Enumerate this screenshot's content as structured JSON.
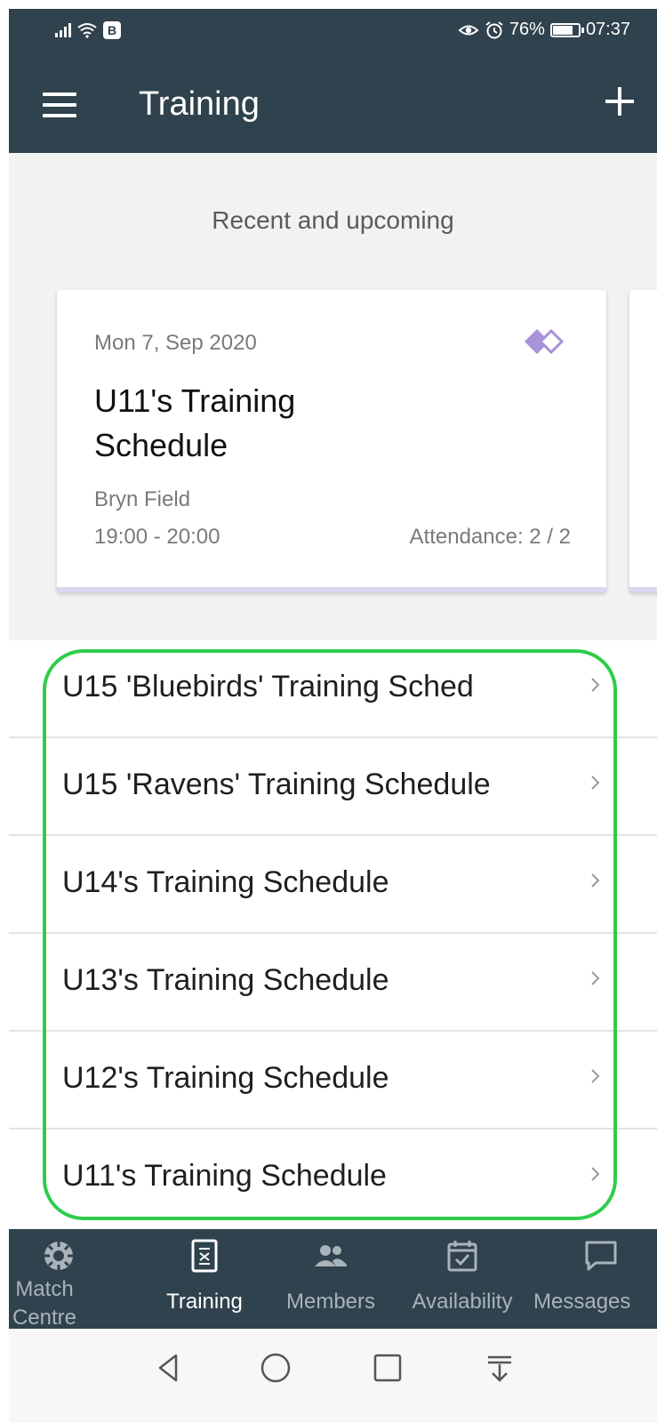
{
  "status_bar": {
    "battery": "76%",
    "time": "07:37",
    "badge": "B"
  },
  "app_bar": {
    "title": "Training",
    "menu_icon": "hamburger-menu-icon",
    "add_icon": "plus-icon"
  },
  "recent": {
    "heading": "Recent and upcoming",
    "card": {
      "date": "Mon 7, Sep 2020",
      "title": "U11's Training Schedule",
      "location": "Bryn Field",
      "time": "19:00 - 20:00",
      "attendance": "Attendance: 2 / 2",
      "icon": "diamond-tag-icon"
    }
  },
  "schedules": [
    {
      "label": "U15 'Bluebirds' Training Sched"
    },
    {
      "label": "U15 'Ravens' Training Schedule"
    },
    {
      "label": "U14's Training Schedule"
    },
    {
      "label": "U13's Training Schedule"
    },
    {
      "label": "U12's Training Schedule"
    },
    {
      "label": "U11's Training Schedule"
    }
  ],
  "bottom_nav": {
    "active": "Training",
    "tabs": [
      {
        "line1": "Match",
        "line2": "Centre",
        "icon": "match-centre-icon"
      },
      {
        "label": "Training",
        "icon": "training-icon"
      },
      {
        "label": "Members",
        "icon": "members-icon"
      },
      {
        "label": "Availability",
        "icon": "calendar-check-icon"
      },
      {
        "label": "Messages",
        "icon": "message-icon"
      }
    ]
  },
  "colors": {
    "bar": "#2f424d",
    "highlight": "#2fcc4a",
    "card_accent": "#a892d8",
    "background": "#f2f2f2"
  }
}
